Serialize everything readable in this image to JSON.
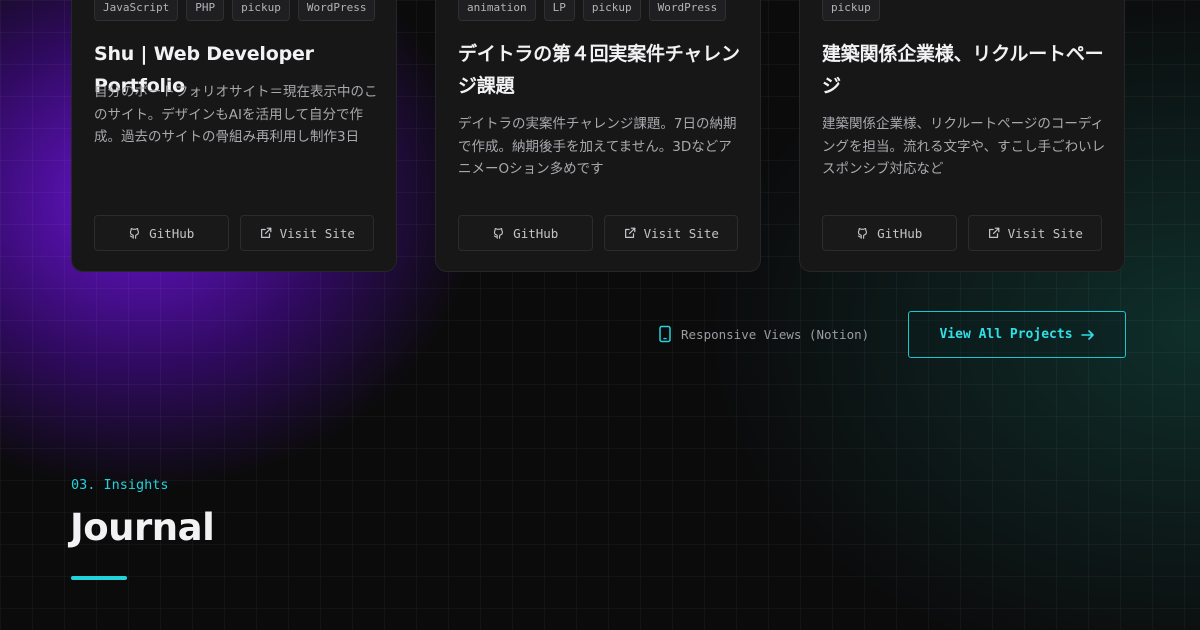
{
  "projects": [
    {
      "tags": [
        "JavaScript",
        "PHP",
        "pickup",
        "WordPress"
      ],
      "title": "Shu | Web Developer Portfolio",
      "description": "自分のポートフォリオサイト＝現在表示中のこのサイト。デザインもAIを活用して自分で作成。過去のサイトの骨組み再利用し制作3日",
      "github_label": "GitHub",
      "visit_label": "Visit Site"
    },
    {
      "tags": [
        "animation",
        "LP",
        "pickup",
        "WordPress"
      ],
      "title": "デイトラの第４回実案件チャレンジ課題",
      "description": "デイトラの実案件チャレンジ課題。7日の納期で作成。納期後手を加えてません。3DなどアニメーOション多めです",
      "github_label": "GitHub",
      "visit_label": "Visit Site"
    },
    {
      "tags": [
        "pickup"
      ],
      "title": "建築関係企業様、リクルートページ",
      "description": "建築関係企業様、リクルートページのコーディングを担当。流れる文字や、すこし手ごわいレスポンシブ対応など",
      "github_label": "GitHub",
      "visit_label": "Visit Site"
    }
  ],
  "responsive_views_label": "Responsive Views (Notion)",
  "view_all_label": "View All Projects",
  "journal": {
    "eyebrow": "03. Insights",
    "heading": "Journal"
  },
  "colors": {
    "accent": "#22d3db",
    "purple_glow": "#6e14dc",
    "card_bg": "#171718"
  },
  "icons": {
    "github": "github-icon",
    "external": "external-link-icon",
    "phone": "smartphone-icon",
    "arrow": "arrow-right-icon"
  }
}
